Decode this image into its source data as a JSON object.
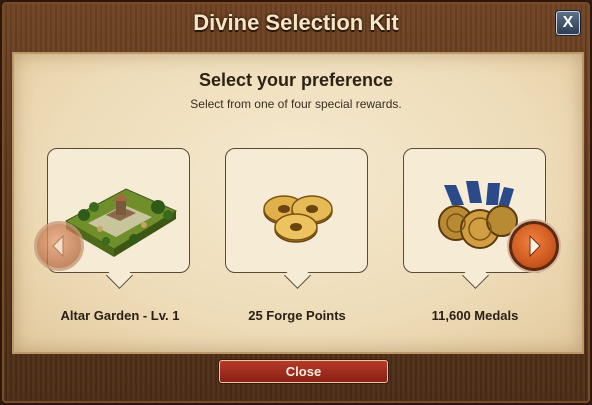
{
  "dialog": {
    "title": "Divine Selection Kit",
    "close_icon_label": "X",
    "heading": "Select your preference",
    "subheading": "Select from one of four special rewards.",
    "close_button_label": "Close"
  },
  "rewards": [
    {
      "label": "Altar Garden - Lv. 1",
      "icon": "altar-garden-icon"
    },
    {
      "label": "25 Forge Points",
      "icon": "forge-points-icon"
    },
    {
      "label": "11,600 Medals",
      "icon": "medals-icon"
    }
  ],
  "navigation": {
    "left_icon": "chevron-left-icon",
    "right_icon": "chevron-right-icon",
    "left_enabled": false,
    "right_enabled": true
  },
  "colors": {
    "frame": "#5a351a",
    "parchment": "#eedcb8",
    "title_text": "#f6e6c6",
    "accent_button": "#a12c1f",
    "close_icon_bg": "#3f4f66"
  }
}
